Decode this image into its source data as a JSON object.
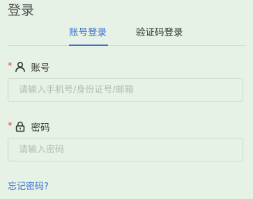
{
  "page": {
    "title": "登录"
  },
  "tabs": [
    {
      "label": "账号登录",
      "active": true
    },
    {
      "label": "验证码登录",
      "active": false
    }
  ],
  "account_field": {
    "required_mark": "*",
    "icon": "user-icon",
    "label": "账号",
    "value": "",
    "placeholder": "请输入手机号/身份证号/邮箱"
  },
  "password_field": {
    "required_mark": "*",
    "icon": "lock-icon",
    "label": "密码",
    "value": "",
    "placeholder": "请输入密码"
  },
  "forgot_password": {
    "label": "忘记密码?"
  },
  "colors": {
    "background": "#e6f2e6",
    "accent": "#3d6fd0",
    "required": "#e0443a",
    "border": "#ccd8cc"
  }
}
